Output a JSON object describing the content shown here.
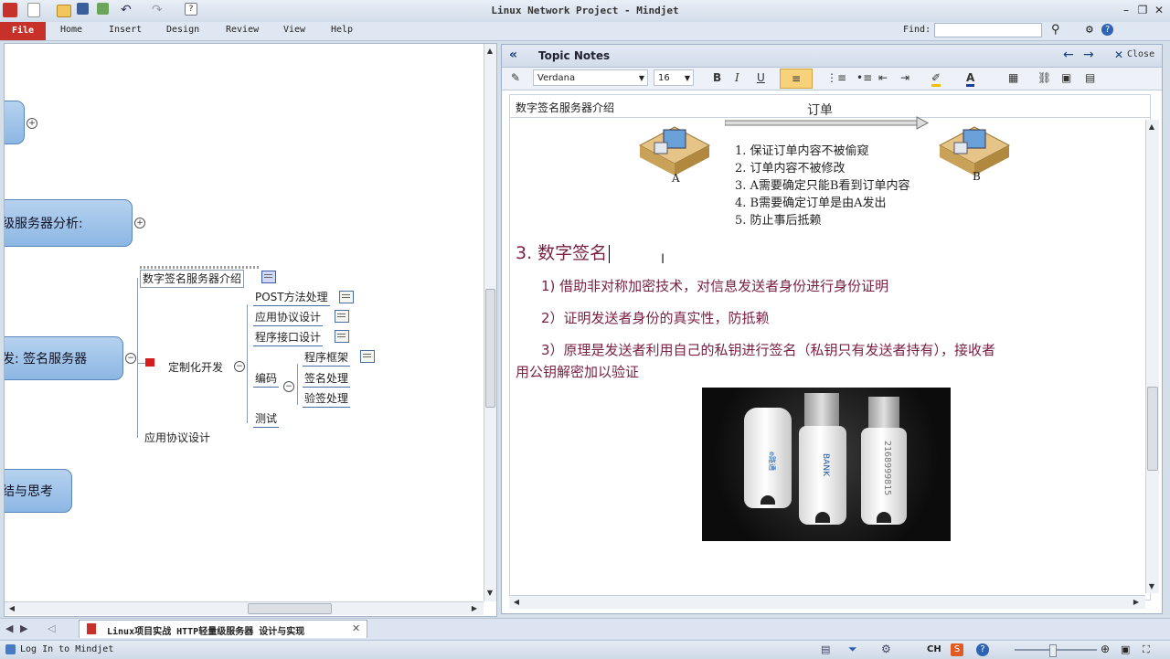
{
  "window": {
    "title": "Linux Network Project - Mindjet"
  },
  "ribbon": {
    "file": "File",
    "tabs": [
      "Home",
      "Insert",
      "Design",
      "Review",
      "View",
      "Help"
    ],
    "find_label": "Find:",
    "find_value": ""
  },
  "map": {
    "node_top": "",
    "node_server_analysis": "级服务器分析:",
    "node_sign_server": "发: 签名服务器",
    "node_summary": "结与思考",
    "topic_selected": "数字签名服务器介绍",
    "topic_custom_dev": "定制化开发",
    "topic_protocol": "应用协议设计",
    "sub_post": "POST方法处理",
    "sub_protocol": "应用协议设计",
    "sub_interface": "程序接口设计",
    "sub_coding": "编码",
    "sub_framework": "程序框架",
    "sub_sign": "签名处理",
    "sub_verify": "验签处理",
    "sub_test": "测试",
    "collapse_plus": "+",
    "collapse_minus": "−"
  },
  "notes": {
    "header_title": "Topic Notes",
    "close_label": "Close",
    "font_name": "Verdana",
    "font_size": "16",
    "topic_title": "数字签名服务器介绍",
    "diagram": {
      "arrow_label": "订单",
      "label_a": "A",
      "label_b": "B",
      "list": [
        "1.  保证订单内容不被偷窥",
        "2.  订单内容不被修改",
        "3.  A需要确定只能B看到订单内容",
        "4.  B需要确定订单是由A发出",
        "5.  防止事后抵赖"
      ]
    },
    "heading": "3. 数字签名",
    "points": [
      "1) 借助非对称加密技术，对信息发送者身份进行身份证明",
      "2）证明发送者身份的真实性，防抵赖",
      "3）原理是发送者利用自己的私钥进行签名（私钥只有发送者持有），接收者",
      "用公钥解密加以验证"
    ],
    "usb_labels": [
      "e路通",
      "BANK",
      "2168999815"
    ]
  },
  "tabs": {
    "doc_tab": "Linux项目实战 HTTP轻量级服务器 设计与实现"
  },
  "status": {
    "login": "Log In to Mindjet",
    "ime": "CH"
  },
  "colors": {
    "accent_file": "#c8312a",
    "note_text": "#7a2044",
    "node_fill": "#a9cbed"
  }
}
